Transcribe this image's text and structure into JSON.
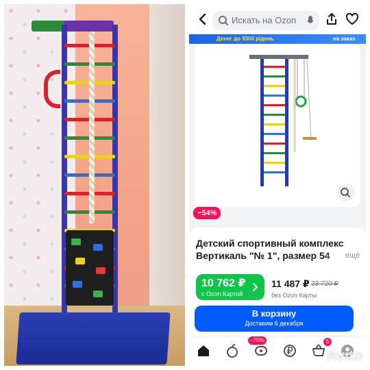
{
  "search": {
    "placeholder": "Искать на Ozon"
  },
  "promo_banner": {
    "left_text": "Денег до 9300 р/день",
    "right_text": "на заказ"
  },
  "discount_badge": "−54%",
  "product": {
    "title_line1": "Детский спортивный комплекс",
    "title_line2": "Вертикаль \"№ 1\", размер 54",
    "more_label": "ещё"
  },
  "price_card": {
    "value": "10 762 ₽",
    "subtitle": "с Ozon Картой"
  },
  "price_regular": {
    "value": "11 487 ₽",
    "old_value": "23 720 ₽",
    "subtitle": "без Ozon Карты"
  },
  "cart_button": {
    "label": "В корзину",
    "delivery": "Доставим 6 декабря"
  },
  "tabbar": {
    "items": [
      {
        "name": "home",
        "icon": "home-icon"
      },
      {
        "name": "fresh",
        "icon": "apple-icon"
      },
      {
        "name": "sale",
        "icon": "sale-icon",
        "badge": "−70%"
      },
      {
        "name": "finance",
        "icon": "ruble-icon"
      },
      {
        "name": "cart",
        "icon": "basket-icon",
        "count": "5"
      },
      {
        "name": "profile",
        "icon": "profile-icon"
      }
    ]
  },
  "watermark": "Avito",
  "colors": {
    "accent": "#005bff",
    "green": "#10c44c",
    "sale": "#f91155"
  }
}
